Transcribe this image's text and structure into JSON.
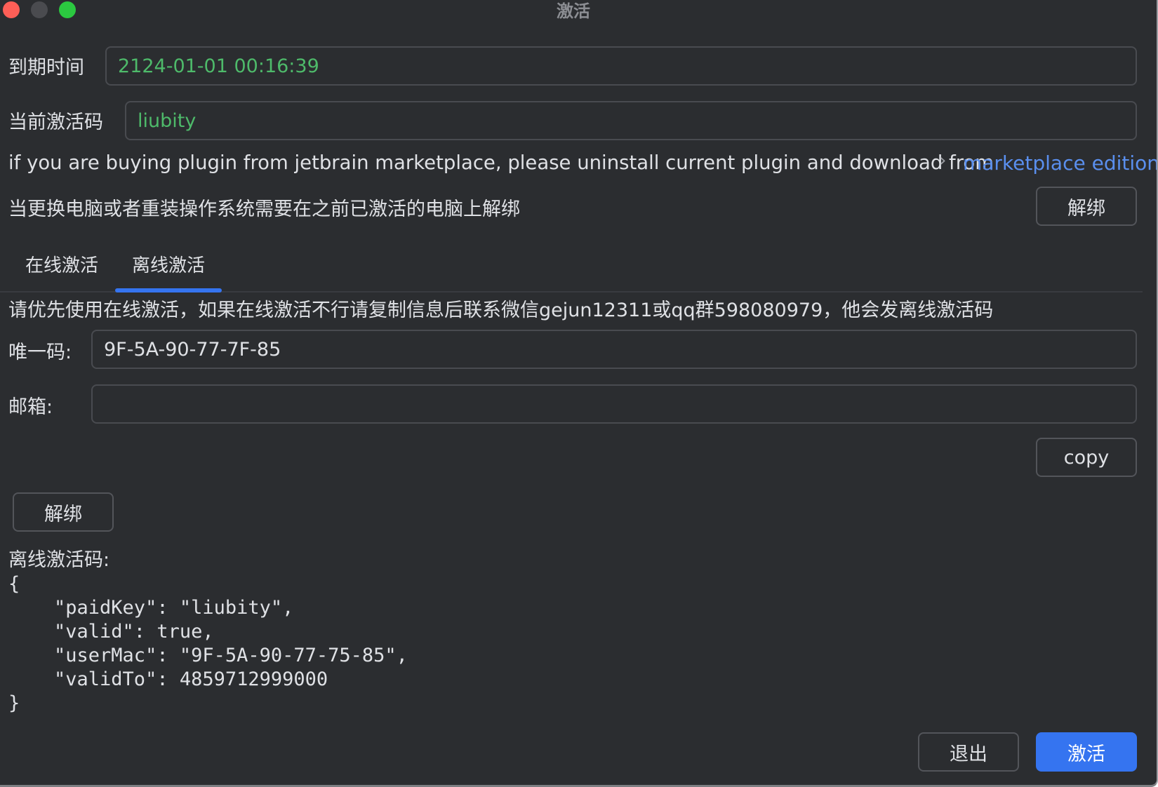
{
  "window": {
    "title": "激活"
  },
  "expiry": {
    "label": "到期时间",
    "value": "2124-01-01 00:16:39"
  },
  "current_code": {
    "label": "当前激活码",
    "value": "liubity"
  },
  "marketplace_note": {
    "text": "if you are buying plugin from jetbrain marketplace, please uninstall current plugin and download from",
    "chevron": "›",
    "link_label": "marketplace edition"
  },
  "unbind_note": {
    "text": "当更换电脑或者重装操作系统需要在之前已激活的电脑上解绑",
    "button_label": "解绑"
  },
  "tabs": [
    {
      "label": "在线激活"
    },
    {
      "label": "离线激活"
    }
  ],
  "active_tab": "离线激活",
  "offline": {
    "notice": "请优先使用在线激活，如果在线激活不行请复制信息后联系微信gejun12311或qq群598080979，他会发离线激活码",
    "unique_id_label": "唯一码:",
    "unique_id_value": "9F-5A-90-77-7F-85",
    "email_label": "邮箱:",
    "email_value": "",
    "copy_label": "copy",
    "unbind_label": "解绑",
    "offline_code_label": "离线激活码:",
    "offline_code_json": "{\n    \"paidKey\": \"liubity\",\n    \"valid\": true,\n    \"userMac\": \"9F-5A-90-77-75-85\",\n    \"validTo\": 4859712999000\n}"
  },
  "footer": {
    "exit_label": "退出",
    "activate_label": "激活"
  },
  "colors": {
    "background": "#2b2d30",
    "accent": "#3574f0",
    "value_green": "#4eba6a",
    "link_blue": "#5a8fee"
  }
}
